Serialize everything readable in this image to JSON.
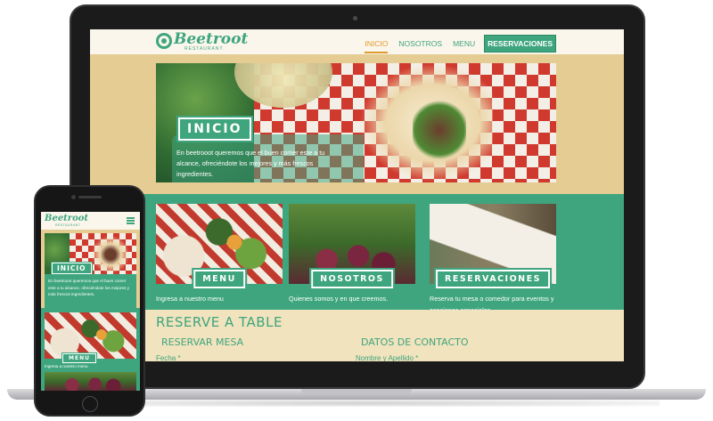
{
  "brand": {
    "name": "Beetroot",
    "tagline": "RESTAURANT",
    "accent_color": "#3ea57f",
    "highlight_color": "#e09a2a",
    "sand_color": "#e4cc93"
  },
  "nav": {
    "items": [
      {
        "label": "INICIO",
        "active": true
      },
      {
        "label": "NOSOTROS",
        "active": false
      },
      {
        "label": "MENU",
        "active": false
      }
    ],
    "cta_label": "RESERVACIONES"
  },
  "hero": {
    "title": "INICIO",
    "text": "En beetrooot queremos que el buen comer este a tu alcance, ofreciéndote los mejores  y más frescos ingredientes."
  },
  "cards": [
    {
      "label": "MENU",
      "text": "Ingresa a nuestro menu"
    },
    {
      "label": "NOSOTROS",
      "text": "Quienes somos y en que creemos."
    },
    {
      "label": "RESERVACIONES",
      "text": "Reserva tu mesa o comedor para eventos y ocasiones especiales."
    }
  ],
  "reserve": {
    "title": "RESERVE A TABLE",
    "left_heading": "RESERVAR MESA",
    "right_heading": "DATOS DE CONTACTO",
    "left_field": "Fecha *",
    "right_field": "Nombre y Apellido *"
  },
  "mobile": {
    "menu_icon": "hamburger-icon",
    "hero_title": "INICIO",
    "hero_text": "En beetrooot queremos que el buen comer este a tu alcance, ofreciéndote los mejores y más frescos ingredientes.",
    "card_label": "MENU",
    "card_text": "Ingresa a nuestro menu"
  }
}
